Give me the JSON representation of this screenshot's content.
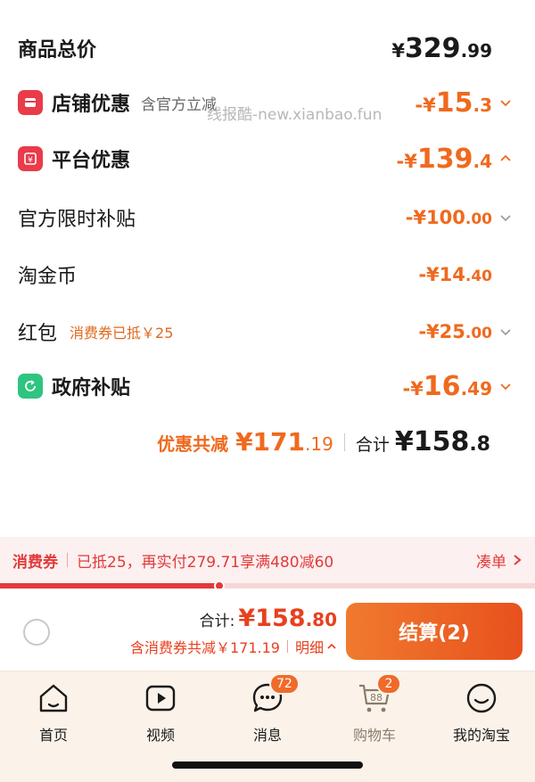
{
  "breakdown": {
    "total_price": {
      "label": "商品总价",
      "currency": "¥",
      "integer": "329",
      "decimal": ".99"
    },
    "store_discount": {
      "label": "店铺优惠",
      "sub": "含官方立减",
      "prefix": "-¥",
      "integer": "15",
      "decimal": ".3",
      "icon": "store-icon"
    },
    "platform_discount": {
      "label": "平台优惠",
      "prefix": "-¥",
      "integer": "139",
      "decimal": ".4",
      "icon": "coupon-icon"
    },
    "official_subsidy": {
      "label": "官方限时补贴",
      "value": "-¥100",
      "decimal": ".00"
    },
    "taojinbi": {
      "label": "淘金币",
      "value": "-¥14",
      "decimal": ".40"
    },
    "red_packet": {
      "label": "红包",
      "note": "消费券已抵￥25",
      "value": "-¥25",
      "decimal": ".00"
    },
    "gov_subsidy": {
      "label": "政府补贴",
      "prefix": "-¥",
      "integer": "16",
      "decimal": ".49",
      "icon": "refresh-icon"
    },
    "summary": {
      "discount_label": "优惠共减",
      "discount_value": "¥171",
      "discount_decimal": ".19",
      "total_label": "合计",
      "total_value": "¥158",
      "total_decimal": ".8"
    }
  },
  "watermark": "线报酷-new.xianbao.fun",
  "coupon_bar": {
    "tag": "消费券",
    "message": "已抵25，再实付279.71享满480减60",
    "link": "凑单",
    "progress": 0.41
  },
  "checkout": {
    "total_label": "合计:",
    "total_value": "¥158",
    "total_decimal": ".80",
    "savings": "含消费券共减￥171.19",
    "details": "明细",
    "pay_button": "结算(2)"
  },
  "tabbar": {
    "items": [
      {
        "label": "首页",
        "icon": "home-icon"
      },
      {
        "label": "视频",
        "icon": "video-icon"
      },
      {
        "label": "消息",
        "icon": "message-icon",
        "badge": "72"
      },
      {
        "label": "购物车",
        "icon": "cart-icon",
        "badge": "2",
        "cart_count": "88"
      },
      {
        "label": "我的淘宝",
        "icon": "profile-icon"
      }
    ]
  },
  "colors": {
    "accent": "#ef6a1e",
    "coupon_red": "#e23a3a",
    "price_red": "#e8401f"
  }
}
